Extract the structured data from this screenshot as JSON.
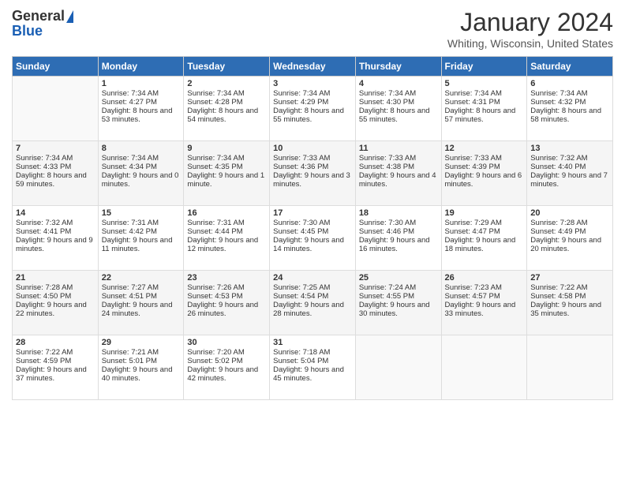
{
  "header": {
    "logo_general": "General",
    "logo_blue": "Blue",
    "month_year": "January 2024",
    "location": "Whiting, Wisconsin, United States"
  },
  "days_of_week": [
    "Sunday",
    "Monday",
    "Tuesday",
    "Wednesday",
    "Thursday",
    "Friday",
    "Saturday"
  ],
  "weeks": [
    [
      {
        "day": "",
        "sunrise": "",
        "sunset": "",
        "daylight": ""
      },
      {
        "day": "1",
        "sunrise": "Sunrise: 7:34 AM",
        "sunset": "Sunset: 4:27 PM",
        "daylight": "Daylight: 8 hours and 53 minutes."
      },
      {
        "day": "2",
        "sunrise": "Sunrise: 7:34 AM",
        "sunset": "Sunset: 4:28 PM",
        "daylight": "Daylight: 8 hours and 54 minutes."
      },
      {
        "day": "3",
        "sunrise": "Sunrise: 7:34 AM",
        "sunset": "Sunset: 4:29 PM",
        "daylight": "Daylight: 8 hours and 55 minutes."
      },
      {
        "day": "4",
        "sunrise": "Sunrise: 7:34 AM",
        "sunset": "Sunset: 4:30 PM",
        "daylight": "Daylight: 8 hours and 55 minutes."
      },
      {
        "day": "5",
        "sunrise": "Sunrise: 7:34 AM",
        "sunset": "Sunset: 4:31 PM",
        "daylight": "Daylight: 8 hours and 57 minutes."
      },
      {
        "day": "6",
        "sunrise": "Sunrise: 7:34 AM",
        "sunset": "Sunset: 4:32 PM",
        "daylight": "Daylight: 8 hours and 58 minutes."
      }
    ],
    [
      {
        "day": "7",
        "sunrise": "Sunrise: 7:34 AM",
        "sunset": "Sunset: 4:33 PM",
        "daylight": "Daylight: 8 hours and 59 minutes."
      },
      {
        "day": "8",
        "sunrise": "Sunrise: 7:34 AM",
        "sunset": "Sunset: 4:34 PM",
        "daylight": "Daylight: 9 hours and 0 minutes."
      },
      {
        "day": "9",
        "sunrise": "Sunrise: 7:34 AM",
        "sunset": "Sunset: 4:35 PM",
        "daylight": "Daylight: 9 hours and 1 minute."
      },
      {
        "day": "10",
        "sunrise": "Sunrise: 7:33 AM",
        "sunset": "Sunset: 4:36 PM",
        "daylight": "Daylight: 9 hours and 3 minutes."
      },
      {
        "day": "11",
        "sunrise": "Sunrise: 7:33 AM",
        "sunset": "Sunset: 4:38 PM",
        "daylight": "Daylight: 9 hours and 4 minutes."
      },
      {
        "day": "12",
        "sunrise": "Sunrise: 7:33 AM",
        "sunset": "Sunset: 4:39 PM",
        "daylight": "Daylight: 9 hours and 6 minutes."
      },
      {
        "day": "13",
        "sunrise": "Sunrise: 7:32 AM",
        "sunset": "Sunset: 4:40 PM",
        "daylight": "Daylight: 9 hours and 7 minutes."
      }
    ],
    [
      {
        "day": "14",
        "sunrise": "Sunrise: 7:32 AM",
        "sunset": "Sunset: 4:41 PM",
        "daylight": "Daylight: 9 hours and 9 minutes."
      },
      {
        "day": "15",
        "sunrise": "Sunrise: 7:31 AM",
        "sunset": "Sunset: 4:42 PM",
        "daylight": "Daylight: 9 hours and 11 minutes."
      },
      {
        "day": "16",
        "sunrise": "Sunrise: 7:31 AM",
        "sunset": "Sunset: 4:44 PM",
        "daylight": "Daylight: 9 hours and 12 minutes."
      },
      {
        "day": "17",
        "sunrise": "Sunrise: 7:30 AM",
        "sunset": "Sunset: 4:45 PM",
        "daylight": "Daylight: 9 hours and 14 minutes."
      },
      {
        "day": "18",
        "sunrise": "Sunrise: 7:30 AM",
        "sunset": "Sunset: 4:46 PM",
        "daylight": "Daylight: 9 hours and 16 minutes."
      },
      {
        "day": "19",
        "sunrise": "Sunrise: 7:29 AM",
        "sunset": "Sunset: 4:47 PM",
        "daylight": "Daylight: 9 hours and 18 minutes."
      },
      {
        "day": "20",
        "sunrise": "Sunrise: 7:28 AM",
        "sunset": "Sunset: 4:49 PM",
        "daylight": "Daylight: 9 hours and 20 minutes."
      }
    ],
    [
      {
        "day": "21",
        "sunrise": "Sunrise: 7:28 AM",
        "sunset": "Sunset: 4:50 PM",
        "daylight": "Daylight: 9 hours and 22 minutes."
      },
      {
        "day": "22",
        "sunrise": "Sunrise: 7:27 AM",
        "sunset": "Sunset: 4:51 PM",
        "daylight": "Daylight: 9 hours and 24 minutes."
      },
      {
        "day": "23",
        "sunrise": "Sunrise: 7:26 AM",
        "sunset": "Sunset: 4:53 PM",
        "daylight": "Daylight: 9 hours and 26 minutes."
      },
      {
        "day": "24",
        "sunrise": "Sunrise: 7:25 AM",
        "sunset": "Sunset: 4:54 PM",
        "daylight": "Daylight: 9 hours and 28 minutes."
      },
      {
        "day": "25",
        "sunrise": "Sunrise: 7:24 AM",
        "sunset": "Sunset: 4:55 PM",
        "daylight": "Daylight: 9 hours and 30 minutes."
      },
      {
        "day": "26",
        "sunrise": "Sunrise: 7:23 AM",
        "sunset": "Sunset: 4:57 PM",
        "daylight": "Daylight: 9 hours and 33 minutes."
      },
      {
        "day": "27",
        "sunrise": "Sunrise: 7:22 AM",
        "sunset": "Sunset: 4:58 PM",
        "daylight": "Daylight: 9 hours and 35 minutes."
      }
    ],
    [
      {
        "day": "28",
        "sunrise": "Sunrise: 7:22 AM",
        "sunset": "Sunset: 4:59 PM",
        "daylight": "Daylight: 9 hours and 37 minutes."
      },
      {
        "day": "29",
        "sunrise": "Sunrise: 7:21 AM",
        "sunset": "Sunset: 5:01 PM",
        "daylight": "Daylight: 9 hours and 40 minutes."
      },
      {
        "day": "30",
        "sunrise": "Sunrise: 7:20 AM",
        "sunset": "Sunset: 5:02 PM",
        "daylight": "Daylight: 9 hours and 42 minutes."
      },
      {
        "day": "31",
        "sunrise": "Sunrise: 7:18 AM",
        "sunset": "Sunset: 5:04 PM",
        "daylight": "Daylight: 9 hours and 45 minutes."
      },
      {
        "day": "",
        "sunrise": "",
        "sunset": "",
        "daylight": ""
      },
      {
        "day": "",
        "sunrise": "",
        "sunset": "",
        "daylight": ""
      },
      {
        "day": "",
        "sunrise": "",
        "sunset": "",
        "daylight": ""
      }
    ]
  ]
}
